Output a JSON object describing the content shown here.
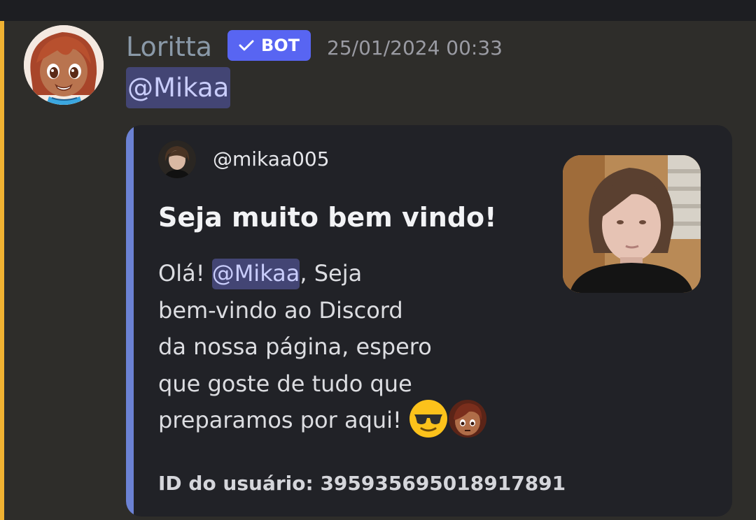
{
  "message": {
    "author": {
      "name": "Loritta",
      "tag": "BOT",
      "avatar_icon": "loritta-avatar",
      "name_color": "#8a99a8"
    },
    "timestamp": "25/01/2024 00:33",
    "mention": "@Mikaa"
  },
  "embed": {
    "accent_color": "#6c82d4",
    "author_name": "@mikaa005",
    "title": "Seja muito bem vindo!",
    "description": {
      "line1_prefix": "Olá! ",
      "mention": "@Mikaa",
      "line1_suffix": ", Seja",
      "line2": "bem-vindo ao Discord",
      "line3": "da nossa página, espero",
      "line4": "que goste de tudo que",
      "line5": "preparamos por aqui!",
      "emojis": [
        "sunglasses-emoji",
        "loritta-emoji"
      ]
    },
    "footer": "ID do usuário: 395935695018917891",
    "thumbnail_icon": "user-photo-thumbnail"
  },
  "colors": {
    "mention_bg": "#434574",
    "mention_text": "#c9cdfb",
    "bot_tag": "#5865f2",
    "highlight_stripe": "#f0b232"
  }
}
